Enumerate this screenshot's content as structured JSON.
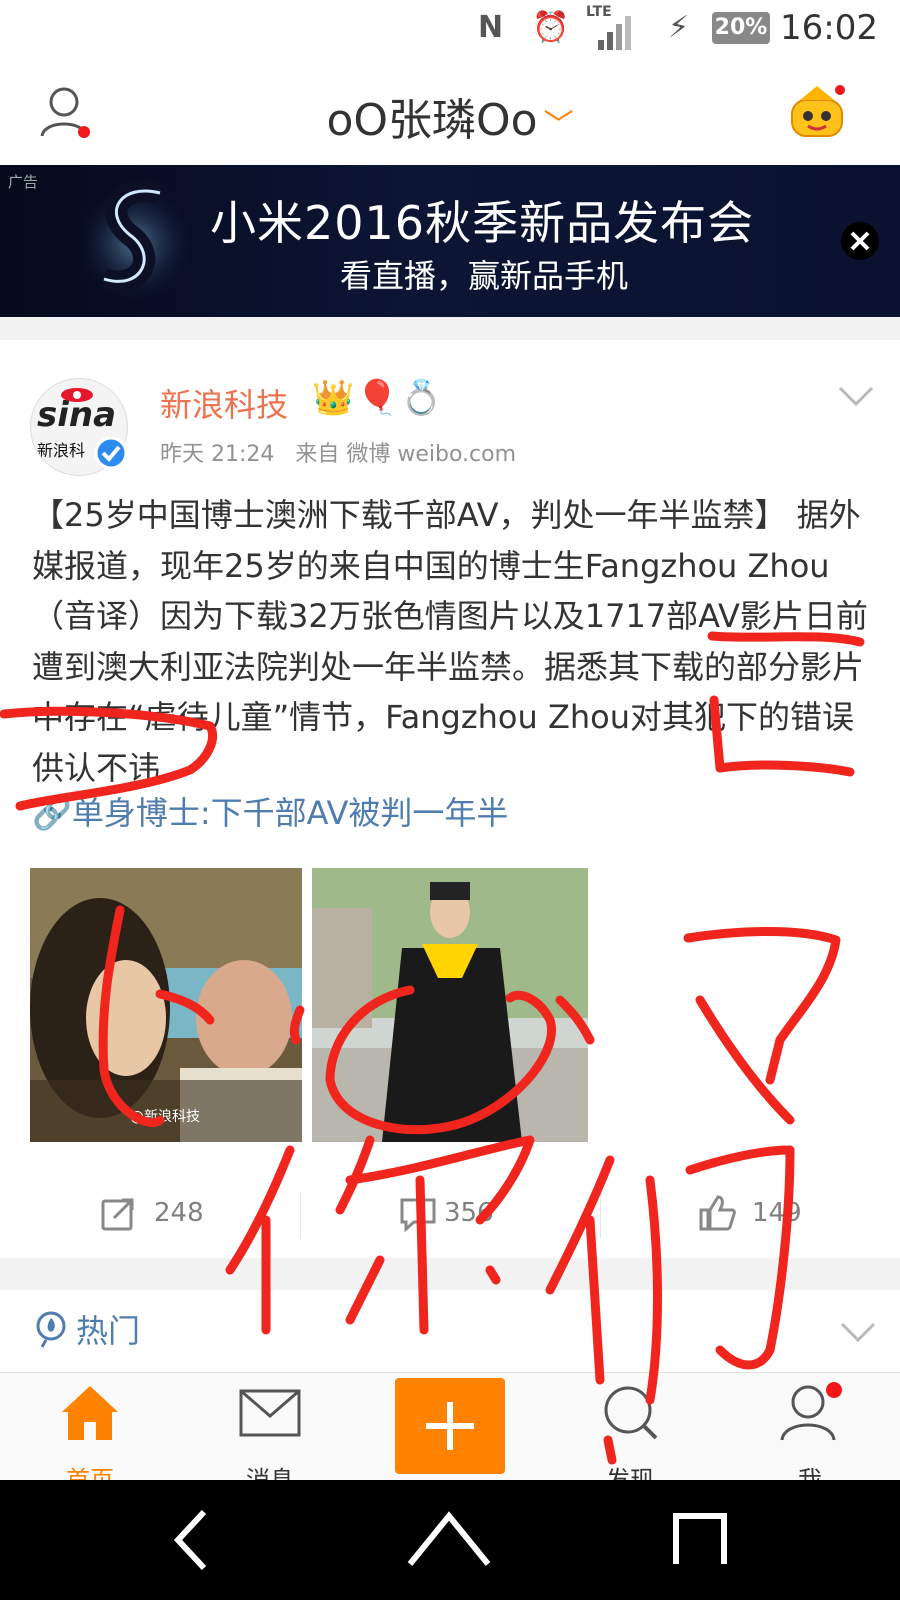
{
  "status_bar": {
    "time": "16:02",
    "battery": "20%",
    "network": "LTE",
    "icons": [
      "nfc-icon",
      "alarm-icon",
      "signal-icon",
      "charging-icon"
    ]
  },
  "header": {
    "title": "oO张璘Oo",
    "dropdown_icon": "chevron-down-icon"
  },
  "ad": {
    "tag": "广告",
    "line1": "小米2016秋季新品发布会",
    "line2": "看直播，赢新品手机"
  },
  "post": {
    "author": "新浪科技",
    "avatar_text": "sina",
    "avatar_sub": "新浪科",
    "time": "昨天 21:24",
    "source": "来自 微博 weibo.com",
    "body": "【25岁中国博士澳洲下载千部AV，判处一年半监禁】 据外媒报道，现年25岁的来自中国的博士生Fangzhou Zhou（音译）因为下载32万张色情图片以及1717部AV影片日前遭到澳大利亚法院判处一年半监禁。据悉其下载的部分影片中存在“虐待儿童”情节，Fangzhou Zhou对其犯下的错误供认不讳",
    "link": "单身博士:下千部AV被判一年半",
    "thumb1_watermark": "@新浪科技",
    "repost_count": "248",
    "comment_count": "356",
    "like_count": "149"
  },
  "hot": {
    "label": "热门"
  },
  "tabs": [
    {
      "label": "首页",
      "color": "#ff8200"
    },
    {
      "label": "消息",
      "color": "#333333"
    },
    {
      "label": "发现",
      "color": "#333333"
    },
    {
      "label": "我",
      "color": "#333333"
    }
  ],
  "colors": {
    "accent": "#ff8200",
    "link": "#507daf",
    "author": "#eb7350",
    "scribble": "#f0261e"
  }
}
